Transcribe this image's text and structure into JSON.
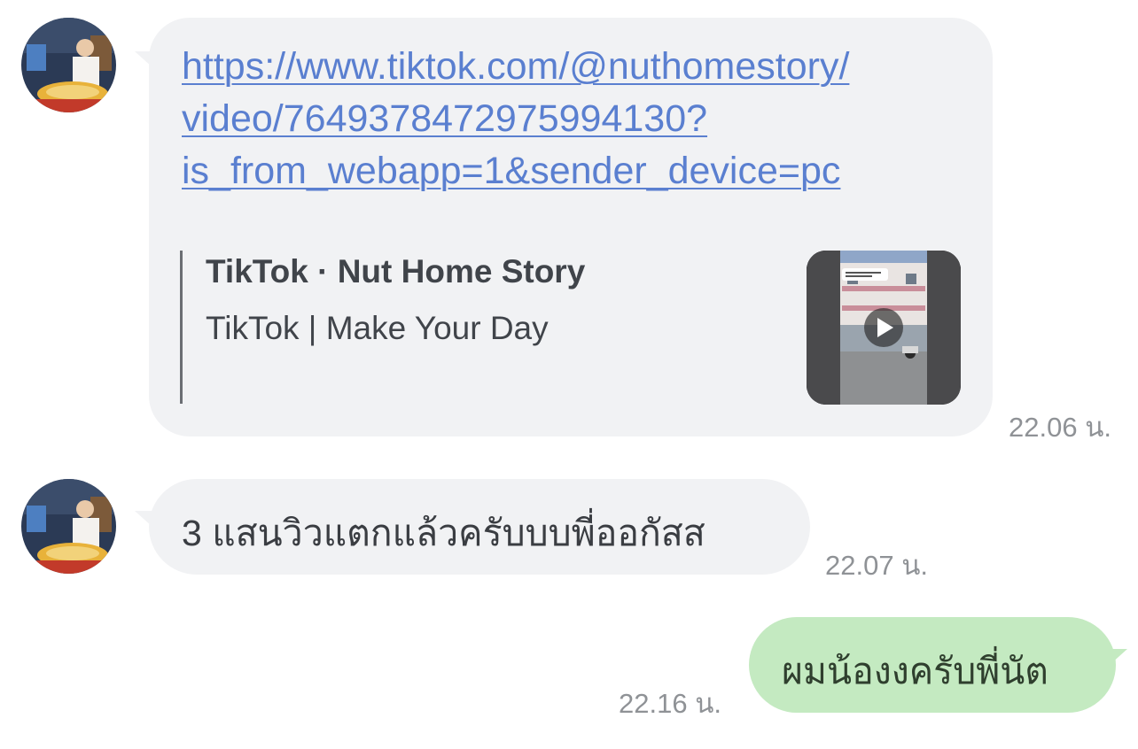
{
  "messages": [
    {
      "direction": "incoming",
      "link_lines": [
        "https://www.tiktok.com/@nuthomestory/",
        "video/7649378472975994130?",
        "is_from_webapp=1&sender_device=pc"
      ],
      "preview": {
        "title": "TikTok · Nut Home Story",
        "description": "TikTok | Make Your Day"
      },
      "time": "22.06 น."
    },
    {
      "direction": "incoming",
      "text": "3 แสนวิวแตกแล้วครับบบพี่ออกัสส",
      "time": "22.07 น."
    },
    {
      "direction": "outgoing",
      "text": "ผมน้องงครับพี่นัต",
      "time": "22.16 น."
    }
  ],
  "icons": {
    "avatar": "avatar-photo",
    "play": "play-icon"
  },
  "colors": {
    "incoming_bubble": "#f1f2f4",
    "outgoing_bubble": "#c4eac1",
    "link": "#5a7fd0",
    "timestamp": "#8f9296"
  }
}
